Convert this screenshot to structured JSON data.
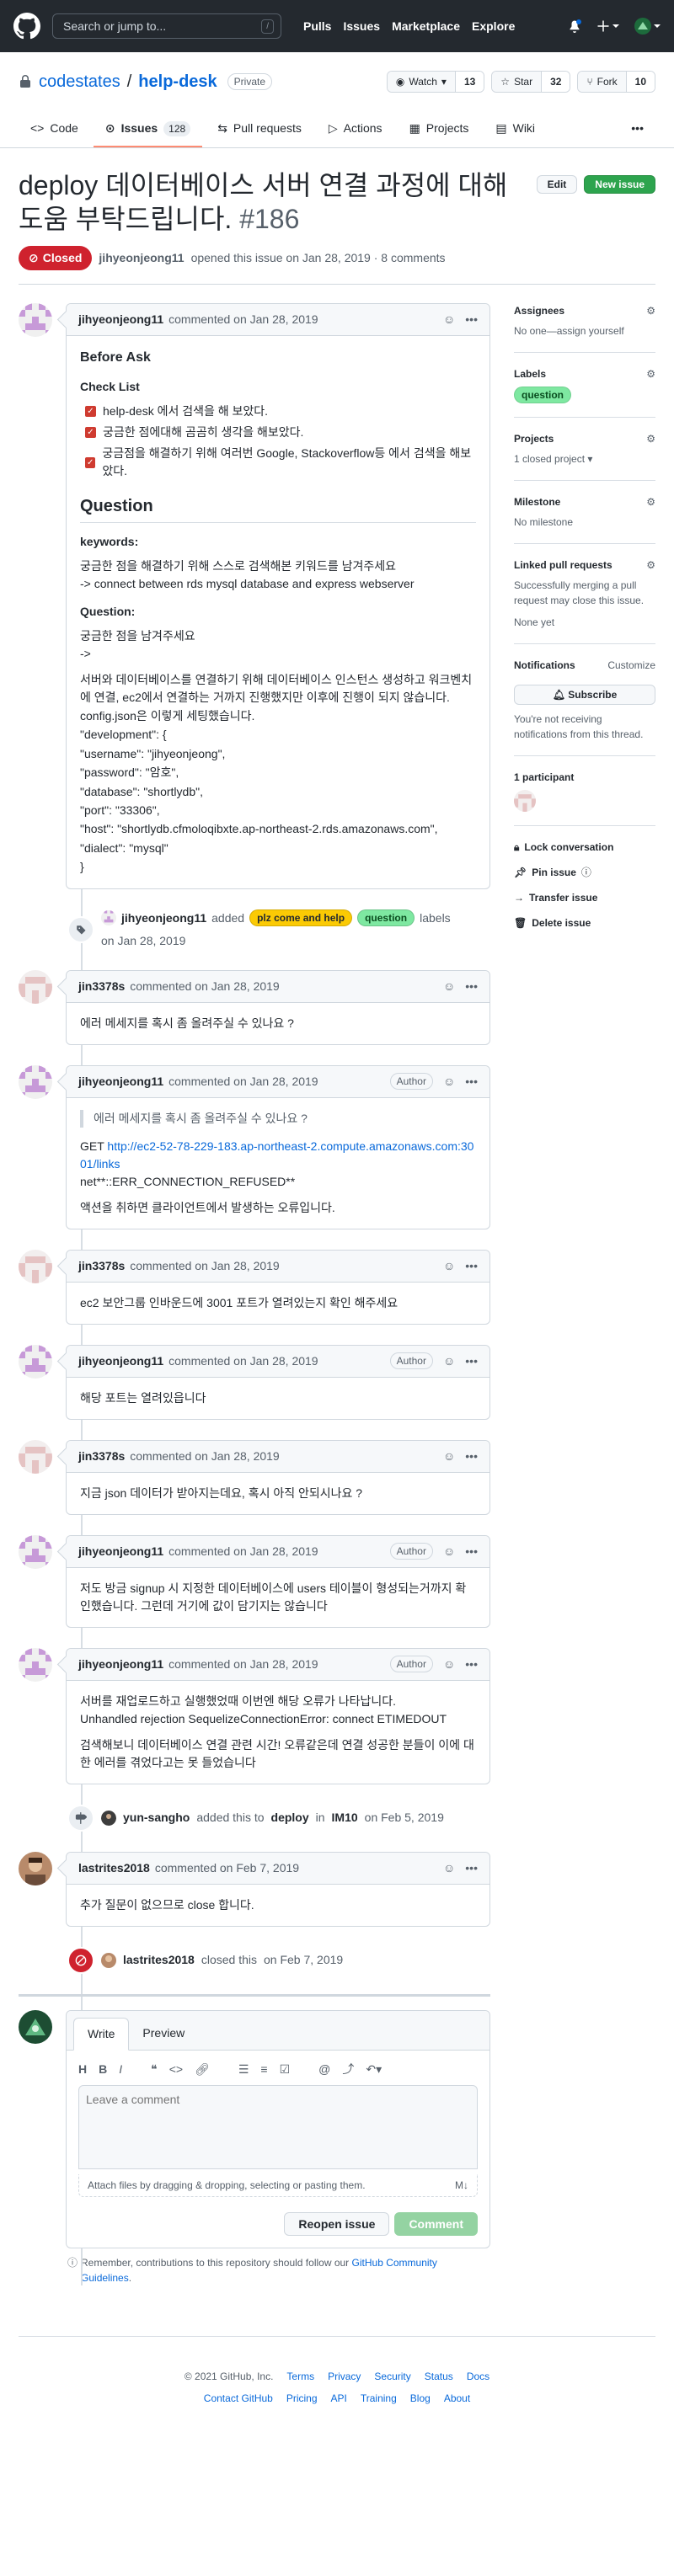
{
  "header": {
    "search_placeholder": "Search or jump to...",
    "search_key": "/",
    "nav": [
      "Pulls",
      "Issues",
      "Marketplace",
      "Explore"
    ]
  },
  "repo": {
    "owner": "codestates",
    "sep": "/",
    "name": "help-desk",
    "visibility": "Private",
    "watch_label": "Watch",
    "watch_count": "13",
    "star_label": "Star",
    "star_count": "32",
    "fork_label": "Fork",
    "fork_count": "10",
    "tabs": [
      {
        "label": "Code"
      },
      {
        "label": "Issues",
        "count": "128"
      },
      {
        "label": "Pull requests"
      },
      {
        "label": "Actions"
      },
      {
        "label": "Projects"
      },
      {
        "label": "Wiki"
      }
    ]
  },
  "issue": {
    "title": "deploy 데이터베이스 서버 연결 과정에 대해 도움 부탁드립니다.",
    "number": "#186",
    "edit_label": "Edit",
    "new_issue_label": "New issue",
    "state": "Closed",
    "author": "jihyeonjeong11",
    "meta": "opened this issue on Jan 28, 2019 · 8 comments"
  },
  "first_comment": {
    "author": "jihyeonjeong11",
    "when": "commented on Jan 28, 2019",
    "h_before": "Before Ask",
    "h_checklist": "Check List",
    "tasks": [
      "help-desk 에서 검색을 해 보았다.",
      "궁금한 점에대해 곰곰히 생각을 해보았다.",
      "궁금점을 해결하기 위해 여러번 Google, Stackoverflow등 에서 검색을 해보았다."
    ],
    "h_question": "Question",
    "h_keywords": "keywords:",
    "kw_1": "궁금한 점을 해결하기 위해 스스로 검색해본 키워드를 남겨주세요",
    "kw_2": "-> connect between rds mysql database and express webserver",
    "h_question2": "Question:",
    "q_1": "궁금한 점을 남겨주세요",
    "q_2": "->",
    "q_body": "서버와 데이터베이스를 연결하기 위해 데이터베이스 인스턴스 생성하고 워크벤치에 연결, ec2에서 연결하는 거까지 진행했지만 이후에 진행이 되지 않습니다.",
    "q_config": "config.json은 이렇게 세팅했습니다.",
    "code": [
      "\"development\": {",
      "\"username\": \"jihyeonjeong\",",
      "\"password\": \"암호\",",
      "\"database\": \"shortlydb\",",
      "\"port\": \"33306\",",
      "\"host\": \"shortlydb.cfmoloqibxte.ap-northeast-2.rds.amazonaws.com\",",
      "\"dialect\": \"mysql\"",
      "}"
    ]
  },
  "label_event": {
    "who": "jihyeonjeong11",
    "added": "added",
    "label1": "plz come and help",
    "label2": "question",
    "tail": "labels",
    "when": "on Jan 28, 2019"
  },
  "comments": [
    {
      "author": "jin3378s",
      "when": "commented on Jan 28, 2019",
      "badge": "",
      "body": "에러 메세지를 혹시 좀 올려주실 수 있나요 ?"
    },
    {
      "author": "jihyeonjeong11",
      "when": "commented on Jan 28, 2019",
      "badge": "Author",
      "quote": "에러 메세지를 혹시 좀 올려주실 수 있나요 ?",
      "get": "GET",
      "link": "http://ec2-52-78-229-183.ap-northeast-2.compute.amazonaws.com:3001/links",
      "err": "net**::ERR_CONNECTION_REFUSED**",
      "tail": "액션을 취하면 클라이언트에서 발생하는 오류입니다."
    },
    {
      "author": "jin3378s",
      "when": "commented on Jan 28, 2019",
      "badge": "",
      "body": "ec2 보안그룹 인바운드에 3001 포트가 열려있는지 확인 해주세요"
    },
    {
      "author": "jihyeonjeong11",
      "when": "commented on Jan 28, 2019",
      "badge": "Author",
      "body": "해당 포트는 열려있읍니다"
    },
    {
      "author": "jin3378s",
      "when": "commented on Jan 28, 2019",
      "badge": "",
      "body": "지금 json 데이터가 받아지는데요, 혹시 아직 안되시나요 ?"
    },
    {
      "author": "jihyeonjeong11",
      "when": "commented on Jan 28, 2019",
      "badge": "Author",
      "body": "저도 방금 signup 시 지정한 데이터베이스에 users 테이블이 형성되는거까지 확인했습니다. 그런데 거기에 값이 담기지는 않습니다"
    },
    {
      "author": "jihyeonjeong11",
      "when": "commented on Jan 28, 2019",
      "badge": "Author",
      "body": "서버를 재업로드하고 실행했었때 이번엔 해당 오류가 나타납니다.",
      "body2": "Unhandled rejection SequelizeConnectionError: connect ETIMEDOUT",
      "body3": "검색해보니 데이터베이스 연결 관련 시간! 오류같은데 연결 성공한 분들이 이에 대한 에러를 겪었다고는 못 들었습니다"
    }
  ],
  "milestone_event": {
    "who": "yun-sangho",
    "text": "added this to",
    "target1": "deploy",
    "in": "in",
    "target2": "IM10",
    "when": "on Feb 5, 2019"
  },
  "last_comment": {
    "author": "lastrites2018",
    "when": "commented on Feb 7, 2019",
    "body": "추가 질문이 없으므로 close 합니다."
  },
  "closed_event": {
    "who": "lastrites2018",
    "text": "closed this",
    "when": "on Feb 7, 2019"
  },
  "form": {
    "tab_write": "Write",
    "tab_preview": "Preview",
    "tools": [
      "H",
      "B",
      "I"
    ],
    "placeholder": "Leave a comment",
    "attach": "Attach files by dragging & dropping, selecting or pasting them.",
    "reopen": "Reopen issue",
    "comment": "Comment",
    "guidelines_pre": "Remember, contributions to this repository should follow our",
    "guidelines_link": "GitHub Community Guidelines",
    "guidelines_post": "."
  },
  "sidebar": {
    "assignees": "Assignees",
    "assignees_val": "No one—assign yourself",
    "labels": "Labels",
    "label_val": "question",
    "projects": "Projects",
    "projects_val": "1 closed project",
    "milestone": "Milestone",
    "milestone_val": "No milestone",
    "linked": "Linked pull requests",
    "linked_val": "Successfully merging a pull request may close this issue.",
    "linked_none": "None yet",
    "notifications": "Notifications",
    "customize": "Customize",
    "subscribe": "Subscribe",
    "notif_text": "You're not receiving notifications from this thread.",
    "participants": "1 participant",
    "lock": "Lock conversation",
    "pin": "Pin issue",
    "transfer": "Transfer issue",
    "delete": "Delete issue"
  },
  "footer": {
    "copyright": "© 2021 GitHub, Inc.",
    "row1": [
      "Terms",
      "Privacy",
      "Security",
      "Status",
      "Docs"
    ],
    "row2": [
      "Contact GitHub",
      "Pricing",
      "API",
      "Training",
      "Blog",
      "About"
    ]
  },
  "colors": {
    "header_bg": "#24292f",
    "closed": "#cf222e",
    "accent_green": "#2da44e",
    "link": "#0969da"
  }
}
